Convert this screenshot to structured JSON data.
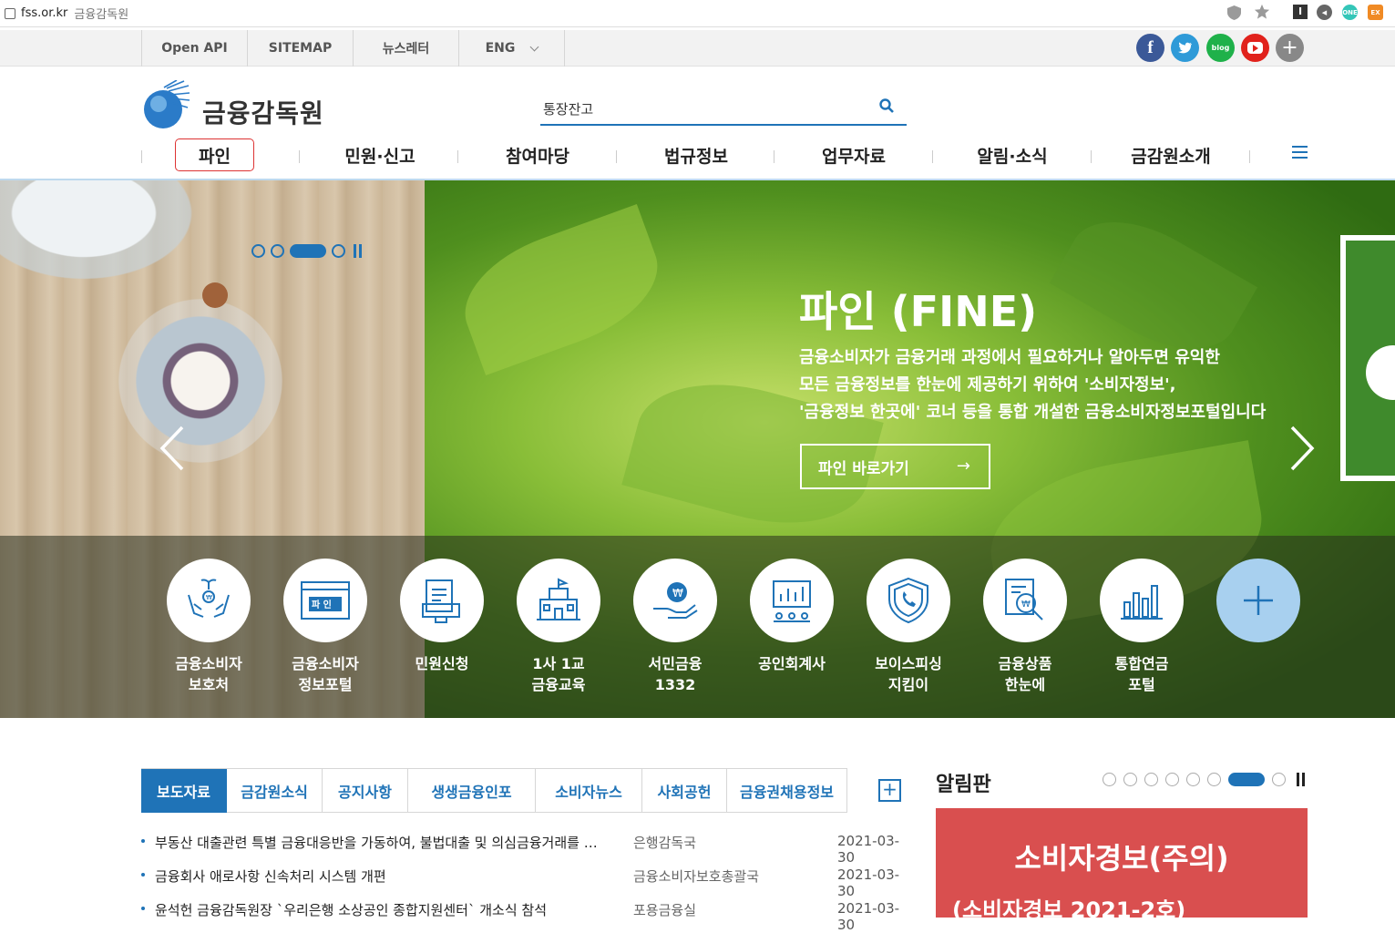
{
  "browser": {
    "domain": "fss.or.kr",
    "page_title": "금융감독원"
  },
  "util_links": [
    {
      "label": "Open API"
    },
    {
      "label": "SITEMAP"
    },
    {
      "label": "뉴스레터"
    },
    {
      "label": "ENG"
    }
  ],
  "social": [
    {
      "name": "facebook",
      "glyph": "f",
      "color": "#3b5998"
    },
    {
      "name": "twitter",
      "glyph": "t",
      "color": "#2e9ad8"
    },
    {
      "name": "blog",
      "glyph": "blog",
      "color": "#1fb14a"
    },
    {
      "name": "youtube",
      "glyph": "▶",
      "color": "#e1221c"
    },
    {
      "name": "more",
      "glyph": "+",
      "color": "#888888"
    }
  ],
  "header": {
    "logo_text": "금융감독원",
    "search_value": "통장잔고"
  },
  "gnb": [
    {
      "label": "파인"
    },
    {
      "label": "민원·신고"
    },
    {
      "label": "참여마당"
    },
    {
      "label": "법규정보"
    },
    {
      "label": "업무자료"
    },
    {
      "label": "알림·소식"
    },
    {
      "label": "금감원소개"
    }
  ],
  "hero": {
    "title": "파인 (FINE)",
    "desc_lines": [
      "금융소비자가 금융거래 과정에서 필요하거나 알아두면 유익한",
      "모든 금융정보를 한눈에 제공하기 위하여 '소비자정보',",
      "'금융정보 한곳에' 코너 등을 통합 개설한 금융소비자정보포털입니다"
    ],
    "button": "파인 바로가기",
    "button_arrow": "→"
  },
  "quick": [
    {
      "label": "금융소비자\n보호처",
      "icon": "hands-coin-icon"
    },
    {
      "label": "금융소비자\n정보포털",
      "icon": "fine-portal-icon"
    },
    {
      "label": "민원신청",
      "icon": "document-pc-icon"
    },
    {
      "label": "1사 1교\n금융교육",
      "icon": "school-icon"
    },
    {
      "label": "서민금융\n1332",
      "icon": "hand-coin-icon"
    },
    {
      "label": "공인회계사",
      "icon": "presentation-icon"
    },
    {
      "label": "보이스피싱\n지킴이",
      "icon": "shield-phone-icon"
    },
    {
      "label": "금융상품\n한눈에",
      "icon": "magnify-document-icon"
    },
    {
      "label": "통합연금\n포털",
      "icon": "bar-chart-icon"
    },
    {
      "label": "",
      "icon": "plus-icon"
    }
  ],
  "tabs": [
    {
      "label": "보도자료"
    },
    {
      "label": "금감원소식"
    },
    {
      "label": "공지사항"
    },
    {
      "label": "생생금융인포"
    },
    {
      "label": "소비자뉴스"
    },
    {
      "label": "사회공헌"
    },
    {
      "label": "금융권채용정보"
    }
  ],
  "news": [
    {
      "title": "부동산 대출관련 특별 금융대응반을 가동하여, 불법대출 및 의심금융거래를 …",
      "dept": "은행감독국",
      "date": "2021-03-30"
    },
    {
      "title": "금융회사 애로사항 신속처리 시스템 개편",
      "dept": "금융소비자보호총괄국",
      "date": "2021-03-30"
    },
    {
      "title": "윤석헌 금융감독원장 `우리은행 소상공인 종합지원센터` 개소식 참석",
      "dept": "포용금융실",
      "date": "2021-03-30"
    }
  ],
  "board": {
    "title": "알림판",
    "head": "소비자경보(주의)",
    "sub": "(소비자경보 2021-2호)"
  },
  "colors": {
    "brand": "#1f73b7",
    "alert": "#d94f4f",
    "active_menu_border": "#dd3333"
  }
}
